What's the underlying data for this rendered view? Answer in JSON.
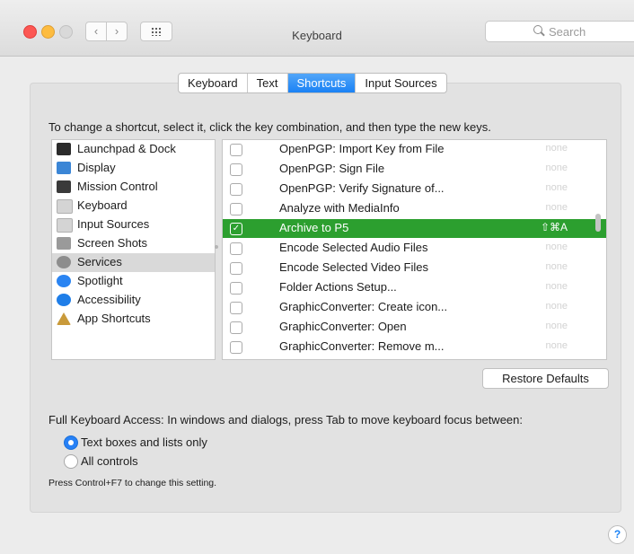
{
  "window": {
    "title": "Keyboard"
  },
  "toolbar": {
    "back_glyph": "‹",
    "forward_glyph": "›",
    "search_placeholder": "Search"
  },
  "tabs": [
    {
      "label": "Keyboard",
      "active": false
    },
    {
      "label": "Text",
      "active": false
    },
    {
      "label": "Shortcuts",
      "active": true
    },
    {
      "label": "Input Sources",
      "active": false
    }
  ],
  "instructions": "To change a shortcut, select it, click the key combination, and then type the new keys.",
  "categories": [
    {
      "label": "Launchpad & Dock",
      "icon": "launchpad-dock-icon",
      "color": "#2b2b2b"
    },
    {
      "label": "Display",
      "icon": "display-icon",
      "color": "#3b86d6"
    },
    {
      "label": "Mission Control",
      "icon": "mission-control-icon",
      "color": "#3a3a3a"
    },
    {
      "label": "Keyboard",
      "icon": "keyboard-icon",
      "color": "#d4d4d4"
    },
    {
      "label": "Input Sources",
      "icon": "input-sources-icon",
      "color": "#d4d4d4"
    },
    {
      "label": "Screen Shots",
      "icon": "screen-shots-icon",
      "color": "#9a9a9a"
    },
    {
      "label": "Services",
      "icon": "services-gear-icon",
      "color": "#8d8d8d",
      "selected": true
    },
    {
      "label": "Spotlight",
      "icon": "spotlight-icon",
      "color": "#2a84f2"
    },
    {
      "label": "Accessibility",
      "icon": "accessibility-icon",
      "color": "#1f7ee8"
    },
    {
      "label": "App Shortcuts",
      "icon": "app-shortcuts-icon",
      "color": "#c99a3a"
    }
  ],
  "services": [
    {
      "name": "OpenPGP: Import Key from File",
      "key": "none",
      "checked": false
    },
    {
      "name": "OpenPGP: Sign File",
      "key": "none",
      "checked": false
    },
    {
      "name": "OpenPGP: Verify Signature of...",
      "key": "none",
      "checked": false
    },
    {
      "name": "Analyze with MediaInfo",
      "key": "none",
      "checked": false
    },
    {
      "name": "Archive to P5",
      "key": "⇧⌘A",
      "checked": true,
      "selected": true
    },
    {
      "name": "Encode Selected Audio Files",
      "key": "none",
      "checked": false
    },
    {
      "name": "Encode Selected Video Files",
      "key": "none",
      "checked": false
    },
    {
      "name": "Folder Actions Setup...",
      "key": "none",
      "checked": false
    },
    {
      "name": "GraphicConverter: Create icon...",
      "key": "none",
      "checked": false
    },
    {
      "name": "GraphicConverter: Open",
      "key": "none",
      "checked": false
    },
    {
      "name": "GraphicConverter: Remove m...",
      "key": "none",
      "checked": false
    }
  ],
  "restore_label": "Restore Defaults",
  "full_keyboard_access": {
    "label": "Full Keyboard Access: In windows and dialogs, press Tab to move keyboard focus between:",
    "options": [
      {
        "label": "Text boxes and lists only",
        "selected": true
      },
      {
        "label": "All controls",
        "selected": false
      }
    ],
    "hint": "Press Control+F7 to change this setting."
  },
  "help_glyph": "?"
}
